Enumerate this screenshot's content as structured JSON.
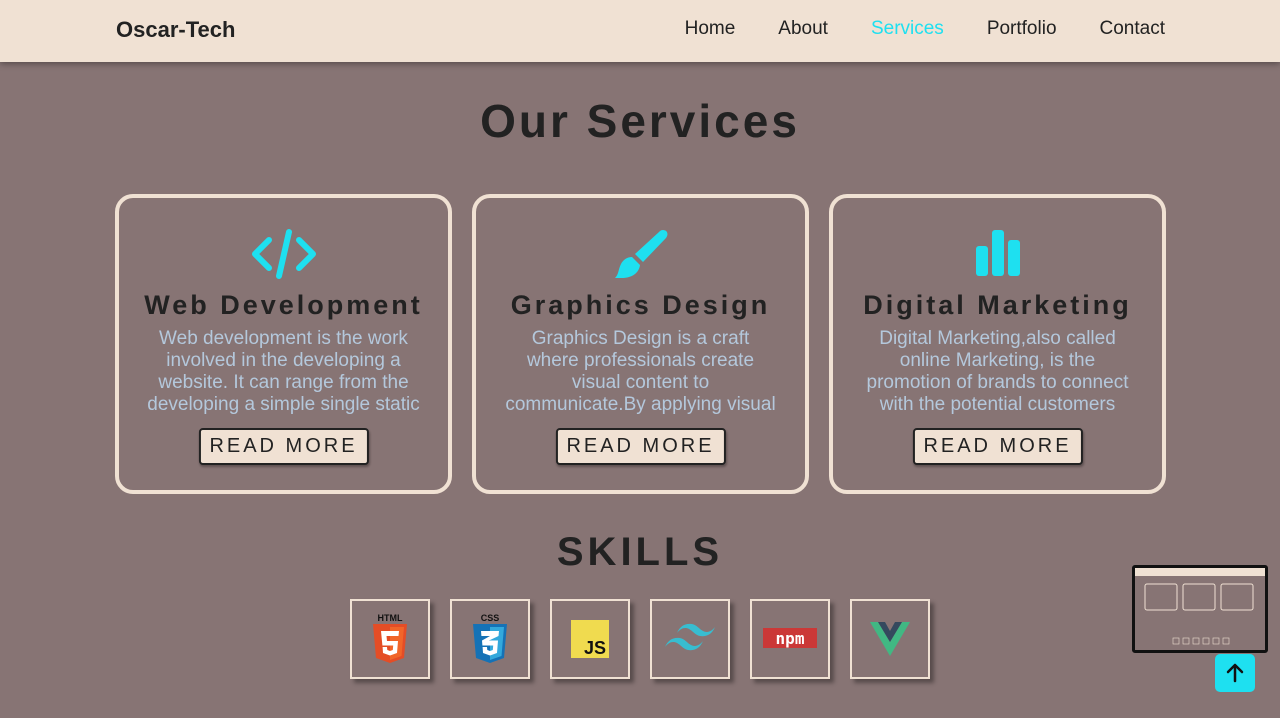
{
  "header": {
    "logo": "Oscar-Tech",
    "nav": [
      {
        "label": "Home",
        "active": false
      },
      {
        "label": "About",
        "active": false
      },
      {
        "label": "Services",
        "active": true
      },
      {
        "label": "Portfolio",
        "active": false
      },
      {
        "label": "Contact",
        "active": false
      }
    ]
  },
  "services": {
    "title": "Our Services",
    "cards": [
      {
        "icon": "code-icon",
        "title": "Web Development",
        "text": "Web development is the work involved in the developing a website. It can range from the developing a simple single static",
        "button": "READ MORE"
      },
      {
        "icon": "paint-brush-icon",
        "title": "Graphics Design",
        "text": "Graphics Design is a craft where professionals create visual content to communicate.By applying visual",
        "button": "READ MORE"
      },
      {
        "icon": "bar-chart-icon",
        "title": "Digital Marketing",
        "text": "Digital Marketing,also called online Marketing, is the promotion of brands to connect with the potential customers using the",
        "button": "READ MORE"
      }
    ]
  },
  "skills": {
    "title": "SKILLS",
    "items": [
      {
        "icon": "html5-icon",
        "label": "HTML"
      },
      {
        "icon": "css3-icon",
        "label": "CSS"
      },
      {
        "icon": "javascript-icon",
        "label": "JS"
      },
      {
        "icon": "tailwind-icon"
      },
      {
        "icon": "npm-icon",
        "label": "npm"
      },
      {
        "icon": "vue-icon"
      }
    ]
  },
  "colors": {
    "background": "#877474",
    "navbar": "#f0e1d3",
    "accent": "#1ee0f0",
    "card_text": "#b4c8dc"
  },
  "scroll_top": {
    "icon": "arrow-up-icon"
  }
}
